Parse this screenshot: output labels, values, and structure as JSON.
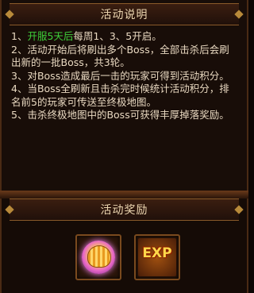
{
  "description": {
    "title": "活动说明",
    "line1_num": "1、",
    "line1_green": "开服5天后",
    "line1_rest": "每周1、3、5开启。",
    "rules": [
      "2、活动开始后将刷出多个Boss，全部击杀后会刷出新的一批Boss，共3轮。",
      "3、对Boss造成最后一击的玩家可得到活动积分。",
      "4、当Boss全刷新且击杀完时候统计活动积分，排名前5的玩家可传送至终极地图。",
      "5、击杀终极地图中的Boss可获得丰厚掉落奖励。"
    ]
  },
  "reward": {
    "title": "活动奖励",
    "items": [
      {
        "icon": "golden-shell-orb-icon"
      },
      {
        "icon": "exp-icon",
        "label": "EXP"
      }
    ]
  },
  "colors": {
    "highlight": "#3ed03a",
    "text": "#e8d8c0",
    "title": "#ecd6b0"
  }
}
